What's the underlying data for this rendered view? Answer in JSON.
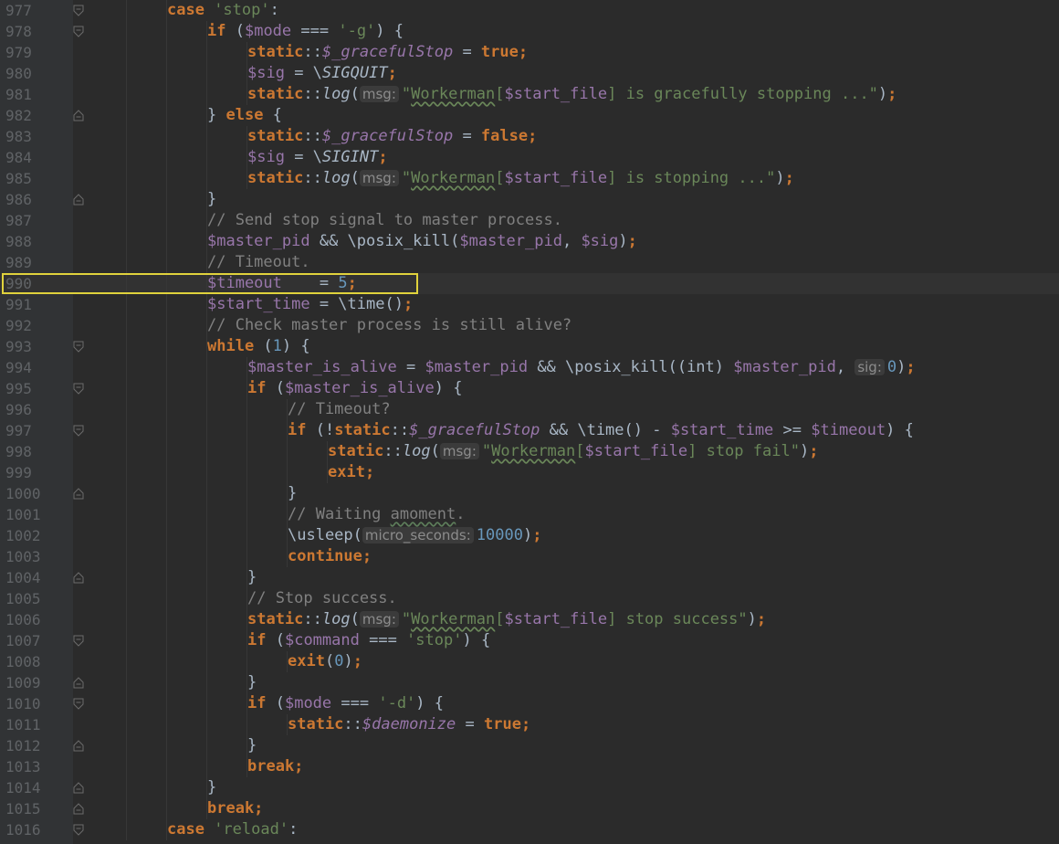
{
  "editor": {
    "highlighted_line": "990",
    "lines": [
      {
        "n": "977",
        "indent": 4,
        "fold": "open",
        "tokens": [
          [
            "kw",
            "case "
          ],
          [
            "str",
            "'stop'"
          ],
          [
            "plain",
            ":"
          ]
        ]
      },
      {
        "n": "978",
        "indent": 5,
        "fold": "open",
        "tokens": [
          [
            "kw",
            "if "
          ],
          [
            "plain",
            "("
          ],
          [
            "var",
            "$mode"
          ],
          [
            "plain",
            " === "
          ],
          [
            "str",
            "'-g'"
          ],
          [
            "plain",
            ") {"
          ]
        ]
      },
      {
        "n": "979",
        "indent": 6,
        "tokens": [
          [
            "kw",
            "static"
          ],
          [
            "plain",
            "::"
          ],
          [
            "sfld",
            "$_gracefulStop"
          ],
          [
            "plain",
            " = "
          ],
          [
            "kw",
            "true"
          ],
          [
            "kw",
            ";"
          ]
        ]
      },
      {
        "n": "980",
        "indent": 6,
        "tokens": [
          [
            "var",
            "$sig"
          ],
          [
            "plain",
            " = \\"
          ],
          [
            "const",
            "SIGQUIT"
          ],
          [
            "kw",
            ";"
          ]
        ]
      },
      {
        "n": "981",
        "indent": 6,
        "tokens": [
          [
            "kw",
            "static"
          ],
          [
            "plain",
            "::"
          ],
          [
            "fn",
            "log"
          ],
          [
            "plain",
            "("
          ],
          [
            "hint",
            "msg:"
          ],
          [
            "str",
            "\""
          ],
          [
            "strtypo",
            "Workerman"
          ],
          [
            "str",
            "["
          ],
          [
            "var",
            "$start_file"
          ],
          [
            "str",
            "] is gracefully stopping ...\""
          ],
          [
            "plain",
            ")"
          ],
          [
            "kw",
            ";"
          ]
        ]
      },
      {
        "n": "982",
        "indent": 5,
        "fold": "mid",
        "tokens": [
          [
            "plain",
            "} "
          ],
          [
            "kw",
            "else "
          ],
          [
            "plain",
            "{"
          ]
        ]
      },
      {
        "n": "983",
        "indent": 6,
        "tokens": [
          [
            "kw",
            "static"
          ],
          [
            "plain",
            "::"
          ],
          [
            "sfld",
            "$_gracefulStop"
          ],
          [
            "plain",
            " = "
          ],
          [
            "kw",
            "false"
          ],
          [
            "kw",
            ";"
          ]
        ]
      },
      {
        "n": "984",
        "indent": 6,
        "tokens": [
          [
            "var",
            "$sig"
          ],
          [
            "plain",
            " = \\"
          ],
          [
            "const",
            "SIGINT"
          ],
          [
            "kw",
            ";"
          ]
        ]
      },
      {
        "n": "985",
        "indent": 6,
        "tokens": [
          [
            "kw",
            "static"
          ],
          [
            "plain",
            "::"
          ],
          [
            "fn",
            "log"
          ],
          [
            "plain",
            "("
          ],
          [
            "hint",
            "msg:"
          ],
          [
            "str",
            "\""
          ],
          [
            "strtypo",
            "Workerman"
          ],
          [
            "str",
            "["
          ],
          [
            "var",
            "$start_file"
          ],
          [
            "str",
            "] is stopping ...\""
          ],
          [
            "plain",
            ")"
          ],
          [
            "kw",
            ";"
          ]
        ]
      },
      {
        "n": "986",
        "indent": 5,
        "fold": "close",
        "tokens": [
          [
            "plain",
            "}"
          ]
        ]
      },
      {
        "n": "987",
        "indent": 5,
        "tokens": [
          [
            "cm",
            "// Send stop signal to master process."
          ]
        ]
      },
      {
        "n": "988",
        "indent": 5,
        "tokens": [
          [
            "var",
            "$master_pid"
          ],
          [
            "plain",
            " && \\posix_kill("
          ],
          [
            "var",
            "$master_pid"
          ],
          [
            "plain",
            ", "
          ],
          [
            "var",
            "$sig"
          ],
          [
            "plain",
            ")"
          ],
          [
            "kw",
            ";"
          ]
        ]
      },
      {
        "n": "989",
        "indent": 5,
        "tokens": [
          [
            "cm",
            "// Timeout."
          ]
        ]
      },
      {
        "n": "990",
        "indent": 5,
        "tokens": [
          [
            "var",
            "$timeout"
          ],
          [
            "plain",
            "    = "
          ],
          [
            "num",
            "5"
          ],
          [
            "kw",
            ";"
          ]
        ]
      },
      {
        "n": "991",
        "indent": 5,
        "tokens": [
          [
            "var",
            "$start_time"
          ],
          [
            "plain",
            " = \\time()"
          ],
          [
            "kw",
            ";"
          ]
        ]
      },
      {
        "n": "992",
        "indent": 5,
        "tokens": [
          [
            "cm",
            "// Check master process is still alive?"
          ]
        ]
      },
      {
        "n": "993",
        "indent": 5,
        "fold": "open",
        "tokens": [
          [
            "kw",
            "while "
          ],
          [
            "plain",
            "("
          ],
          [
            "num",
            "1"
          ],
          [
            "plain",
            ") {"
          ]
        ]
      },
      {
        "n": "994",
        "indent": 6,
        "tokens": [
          [
            "var",
            "$master_is_alive"
          ],
          [
            "plain",
            " = "
          ],
          [
            "var",
            "$master_pid"
          ],
          [
            "plain",
            " && \\posix_kill((int) "
          ],
          [
            "var",
            "$master_pid"
          ],
          [
            "plain",
            ", "
          ],
          [
            "hint",
            "sig:"
          ],
          [
            "num",
            "0"
          ],
          [
            "plain",
            ")"
          ],
          [
            "kw",
            ";"
          ]
        ]
      },
      {
        "n": "995",
        "indent": 6,
        "fold": "open",
        "tokens": [
          [
            "kw",
            "if "
          ],
          [
            "plain",
            "("
          ],
          [
            "var",
            "$master_is_alive"
          ],
          [
            "plain",
            ") {"
          ]
        ]
      },
      {
        "n": "996",
        "indent": 7,
        "tokens": [
          [
            "cm",
            "// Timeout?"
          ]
        ]
      },
      {
        "n": "997",
        "indent": 7,
        "fold": "open",
        "tokens": [
          [
            "kw",
            "if "
          ],
          [
            "plain",
            "(!"
          ],
          [
            "kw",
            "static"
          ],
          [
            "plain",
            "::"
          ],
          [
            "sfld",
            "$_gracefulStop"
          ],
          [
            "plain",
            " && \\time() - "
          ],
          [
            "var",
            "$start_time"
          ],
          [
            "plain",
            " >= "
          ],
          [
            "var",
            "$timeout"
          ],
          [
            "plain",
            ") {"
          ]
        ]
      },
      {
        "n": "998",
        "indent": 8,
        "tokens": [
          [
            "kw",
            "static"
          ],
          [
            "plain",
            "::"
          ],
          [
            "fn",
            "log"
          ],
          [
            "plain",
            "("
          ],
          [
            "hint",
            "msg:"
          ],
          [
            "str",
            "\""
          ],
          [
            "strtypo",
            "Workerman"
          ],
          [
            "str",
            "["
          ],
          [
            "var",
            "$start_file"
          ],
          [
            "str",
            "] stop fail\""
          ],
          [
            "plain",
            ")"
          ],
          [
            "kw",
            ";"
          ]
        ]
      },
      {
        "n": "999",
        "indent": 8,
        "tokens": [
          [
            "kw",
            "exit;"
          ]
        ]
      },
      {
        "n": "1000",
        "indent": 7,
        "fold": "close",
        "tokens": [
          [
            "plain",
            "}"
          ]
        ]
      },
      {
        "n": "1001",
        "indent": 7,
        "tokens": [
          [
            "cm",
            "// Waiting "
          ],
          [
            "cmtypo",
            "amoment"
          ],
          [
            "cm",
            "."
          ]
        ]
      },
      {
        "n": "1002",
        "indent": 7,
        "tokens": [
          [
            "plain",
            "\\usleep("
          ],
          [
            "hint",
            "micro_seconds:"
          ],
          [
            "num",
            "10000"
          ],
          [
            "plain",
            ")"
          ],
          [
            "kw",
            ";"
          ]
        ]
      },
      {
        "n": "1003",
        "indent": 7,
        "tokens": [
          [
            "kw",
            "continue;"
          ]
        ]
      },
      {
        "n": "1004",
        "indent": 6,
        "fold": "close",
        "tokens": [
          [
            "plain",
            "}"
          ]
        ]
      },
      {
        "n": "1005",
        "indent": 6,
        "tokens": [
          [
            "cm",
            "// Stop success."
          ]
        ]
      },
      {
        "n": "1006",
        "indent": 6,
        "tokens": [
          [
            "kw",
            "static"
          ],
          [
            "plain",
            "::"
          ],
          [
            "fn",
            "log"
          ],
          [
            "plain",
            "("
          ],
          [
            "hint",
            "msg:"
          ],
          [
            "str",
            "\""
          ],
          [
            "strtypo",
            "Workerman"
          ],
          [
            "str",
            "["
          ],
          [
            "var",
            "$start_file"
          ],
          [
            "str",
            "] stop success\""
          ],
          [
            "plain",
            ")"
          ],
          [
            "kw",
            ";"
          ]
        ]
      },
      {
        "n": "1007",
        "indent": 6,
        "fold": "open",
        "tokens": [
          [
            "kw",
            "if "
          ],
          [
            "plain",
            "("
          ],
          [
            "var",
            "$command"
          ],
          [
            "plain",
            " === "
          ],
          [
            "str",
            "'stop'"
          ],
          [
            "plain",
            ") {"
          ]
        ]
      },
      {
        "n": "1008",
        "indent": 7,
        "tokens": [
          [
            "kw",
            "exit"
          ],
          [
            "plain",
            "("
          ],
          [
            "num",
            "0"
          ],
          [
            "plain",
            ")"
          ],
          [
            "kw",
            ";"
          ]
        ]
      },
      {
        "n": "1009",
        "indent": 6,
        "fold": "close",
        "tokens": [
          [
            "plain",
            "}"
          ]
        ]
      },
      {
        "n": "1010",
        "indent": 6,
        "fold": "open",
        "tokens": [
          [
            "kw",
            "if "
          ],
          [
            "plain",
            "("
          ],
          [
            "var",
            "$mode"
          ],
          [
            "plain",
            " === "
          ],
          [
            "str",
            "'-d'"
          ],
          [
            "plain",
            ") {"
          ]
        ]
      },
      {
        "n": "1011",
        "indent": 7,
        "tokens": [
          [
            "kw",
            "static"
          ],
          [
            "plain",
            "::"
          ],
          [
            "sfld",
            "$daemonize"
          ],
          [
            "plain",
            " = "
          ],
          [
            "kw",
            "true"
          ],
          [
            "kw",
            ";"
          ]
        ]
      },
      {
        "n": "1012",
        "indent": 6,
        "fold": "close",
        "tokens": [
          [
            "plain",
            "}"
          ]
        ]
      },
      {
        "n": "1013",
        "indent": 6,
        "tokens": [
          [
            "kw",
            "break;"
          ]
        ]
      },
      {
        "n": "1014",
        "indent": 5,
        "fold": "close",
        "tokens": [
          [
            "plain",
            "}"
          ]
        ]
      },
      {
        "n": "1015",
        "indent": 5,
        "fold": "close",
        "tokens": [
          [
            "kw",
            "break;"
          ]
        ]
      },
      {
        "n": "1016",
        "indent": 4,
        "fold": "open",
        "tokens": [
          [
            "kw",
            "case "
          ],
          [
            "str",
            "'reload'"
          ],
          [
            "plain",
            ":"
          ]
        ]
      }
    ]
  }
}
